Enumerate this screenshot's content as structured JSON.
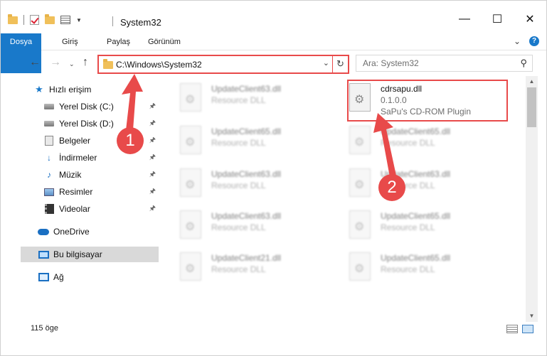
{
  "window": {
    "title": "System32"
  },
  "ribbon": {
    "tabs": [
      "Dosya",
      "Giriş",
      "Paylaş",
      "Görünüm"
    ]
  },
  "navbar": {
    "address": "C:\\Windows\\System32",
    "search_placeholder": "Ara: System32"
  },
  "nav_pane": {
    "quick_access": "Hızlı erişim",
    "items": [
      {
        "label": "Yerel Disk (C:)",
        "icon": "drive-icon",
        "pinned": true
      },
      {
        "label": "Yerel Disk (D:)",
        "icon": "drive-icon",
        "pinned": true
      },
      {
        "label": "Belgeler",
        "icon": "documents-icon",
        "pinned": true
      },
      {
        "label": "İndirmeler",
        "icon": "downloads-icon",
        "pinned": true
      },
      {
        "label": "Müzik",
        "icon": "music-icon",
        "pinned": true
      },
      {
        "label": "Resimler",
        "icon": "pictures-icon",
        "pinned": true
      },
      {
        "label": "Videolar",
        "icon": "videos-icon",
        "pinned": true
      }
    ],
    "onedrive": "OneDrive",
    "this_pc": "Bu bilgisayar",
    "network": "Ağ"
  },
  "files": {
    "left_column": [
      {
        "name": "UpdateClient63.dll",
        "desc": "Resource DLL"
      },
      {
        "name": "UpdateClient65.dll",
        "desc": "Resource DLL"
      },
      {
        "name": "UpdateClient63.dll",
        "desc": "Resource DLL"
      },
      {
        "name": "UpdateClient63.dll",
        "desc": "Resource DLL"
      },
      {
        "name": "UpdateClient21.dll",
        "desc": "Resource DLL"
      }
    ],
    "highlighted": {
      "name": "cdrsapu.dll",
      "version": "0.1.0.0",
      "desc": "SaPu's CD-ROM Plugin"
    },
    "right_column": [
      {
        "name": "UpdateClient65.dll",
        "desc": "Resource DLL"
      },
      {
        "name": "UpdateClient63.dll",
        "desc": "Resource DLL"
      },
      {
        "name": "UpdateClient65.dll",
        "desc": "Resource DLL"
      },
      {
        "name": "UpdateClient65.dll",
        "desc": "Resource DLL"
      }
    ]
  },
  "status": {
    "count": "115 öge"
  },
  "callouts": {
    "one": "1",
    "two": "2",
    "color": "#e84a4a"
  },
  "colors": {
    "accent": "#1979ca"
  }
}
